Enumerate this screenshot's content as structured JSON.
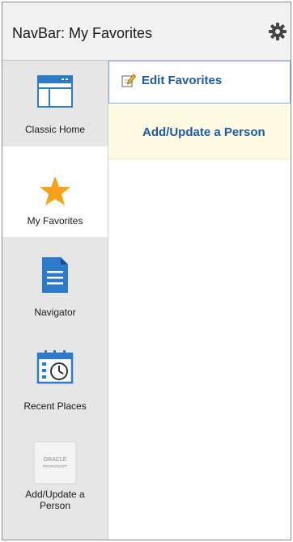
{
  "header": {
    "title": "NavBar: My Favorites"
  },
  "sidebar": {
    "items": [
      {
        "label": "Classic Home",
        "icon": "classic-home-icon"
      },
      {
        "label": "My Favorites",
        "icon": "star-icon"
      },
      {
        "label": "Navigator",
        "icon": "document-icon"
      },
      {
        "label": "Recent Places",
        "icon": "calendar-clock-icon"
      },
      {
        "label": "Add/Update a Person",
        "icon": "oracle-peoplesoft-logo",
        "logo_text": [
          "ORACLE",
          "PEOPLESOFT"
        ]
      }
    ]
  },
  "content": {
    "edit_favorites": "Edit Favorites",
    "favorites": [
      "Add/Update a Person"
    ]
  },
  "colors": {
    "link": "#1e5aa5",
    "star": "#f7a21a",
    "icon_blue": "#2d7ac8",
    "highlight": "#fdfbe3"
  }
}
